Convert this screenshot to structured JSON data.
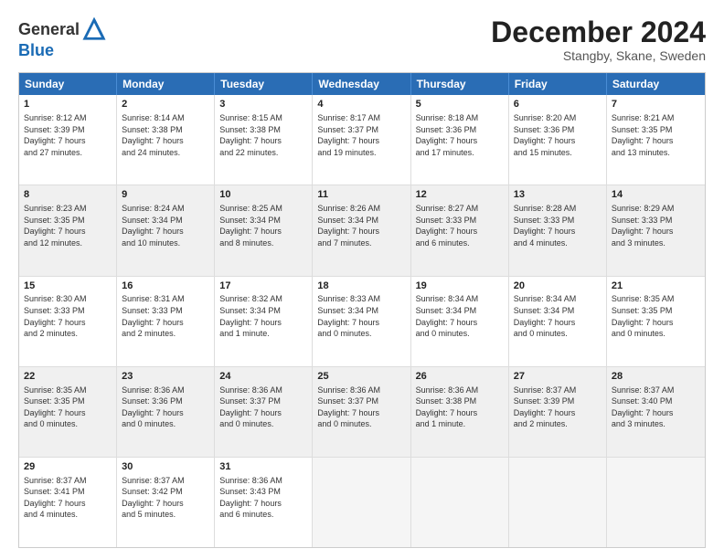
{
  "header": {
    "logo_general": "General",
    "logo_blue": "Blue",
    "month_title": "December 2024",
    "location": "Stangby, Skane, Sweden"
  },
  "weekdays": [
    "Sunday",
    "Monday",
    "Tuesday",
    "Wednesday",
    "Thursday",
    "Friday",
    "Saturday"
  ],
  "rows": [
    [
      {
        "day": "1",
        "lines": [
          "Sunrise: 8:12 AM",
          "Sunset: 3:39 PM",
          "Daylight: 7 hours",
          "and 27 minutes."
        ]
      },
      {
        "day": "2",
        "lines": [
          "Sunrise: 8:14 AM",
          "Sunset: 3:38 PM",
          "Daylight: 7 hours",
          "and 24 minutes."
        ]
      },
      {
        "day": "3",
        "lines": [
          "Sunrise: 8:15 AM",
          "Sunset: 3:38 PM",
          "Daylight: 7 hours",
          "and 22 minutes."
        ]
      },
      {
        "day": "4",
        "lines": [
          "Sunrise: 8:17 AM",
          "Sunset: 3:37 PM",
          "Daylight: 7 hours",
          "and 19 minutes."
        ]
      },
      {
        "day": "5",
        "lines": [
          "Sunrise: 8:18 AM",
          "Sunset: 3:36 PM",
          "Daylight: 7 hours",
          "and 17 minutes."
        ]
      },
      {
        "day": "6",
        "lines": [
          "Sunrise: 8:20 AM",
          "Sunset: 3:36 PM",
          "Daylight: 7 hours",
          "and 15 minutes."
        ]
      },
      {
        "day": "7",
        "lines": [
          "Sunrise: 8:21 AM",
          "Sunset: 3:35 PM",
          "Daylight: 7 hours",
          "and 13 minutes."
        ]
      }
    ],
    [
      {
        "day": "8",
        "lines": [
          "Sunrise: 8:23 AM",
          "Sunset: 3:35 PM",
          "Daylight: 7 hours",
          "and 12 minutes."
        ]
      },
      {
        "day": "9",
        "lines": [
          "Sunrise: 8:24 AM",
          "Sunset: 3:34 PM",
          "Daylight: 7 hours",
          "and 10 minutes."
        ]
      },
      {
        "day": "10",
        "lines": [
          "Sunrise: 8:25 AM",
          "Sunset: 3:34 PM",
          "Daylight: 7 hours",
          "and 8 minutes."
        ]
      },
      {
        "day": "11",
        "lines": [
          "Sunrise: 8:26 AM",
          "Sunset: 3:34 PM",
          "Daylight: 7 hours",
          "and 7 minutes."
        ]
      },
      {
        "day": "12",
        "lines": [
          "Sunrise: 8:27 AM",
          "Sunset: 3:33 PM",
          "Daylight: 7 hours",
          "and 6 minutes."
        ]
      },
      {
        "day": "13",
        "lines": [
          "Sunrise: 8:28 AM",
          "Sunset: 3:33 PM",
          "Daylight: 7 hours",
          "and 4 minutes."
        ]
      },
      {
        "day": "14",
        "lines": [
          "Sunrise: 8:29 AM",
          "Sunset: 3:33 PM",
          "Daylight: 7 hours",
          "and 3 minutes."
        ]
      }
    ],
    [
      {
        "day": "15",
        "lines": [
          "Sunrise: 8:30 AM",
          "Sunset: 3:33 PM",
          "Daylight: 7 hours",
          "and 2 minutes."
        ]
      },
      {
        "day": "16",
        "lines": [
          "Sunrise: 8:31 AM",
          "Sunset: 3:33 PM",
          "Daylight: 7 hours",
          "and 2 minutes."
        ]
      },
      {
        "day": "17",
        "lines": [
          "Sunrise: 8:32 AM",
          "Sunset: 3:34 PM",
          "Daylight: 7 hours",
          "and 1 minute."
        ]
      },
      {
        "day": "18",
        "lines": [
          "Sunrise: 8:33 AM",
          "Sunset: 3:34 PM",
          "Daylight: 7 hours",
          "and 0 minutes."
        ]
      },
      {
        "day": "19",
        "lines": [
          "Sunrise: 8:34 AM",
          "Sunset: 3:34 PM",
          "Daylight: 7 hours",
          "and 0 minutes."
        ]
      },
      {
        "day": "20",
        "lines": [
          "Sunrise: 8:34 AM",
          "Sunset: 3:34 PM",
          "Daylight: 7 hours",
          "and 0 minutes."
        ]
      },
      {
        "day": "21",
        "lines": [
          "Sunrise: 8:35 AM",
          "Sunset: 3:35 PM",
          "Daylight: 7 hours",
          "and 0 minutes."
        ]
      }
    ],
    [
      {
        "day": "22",
        "lines": [
          "Sunrise: 8:35 AM",
          "Sunset: 3:35 PM",
          "Daylight: 7 hours",
          "and 0 minutes."
        ]
      },
      {
        "day": "23",
        "lines": [
          "Sunrise: 8:36 AM",
          "Sunset: 3:36 PM",
          "Daylight: 7 hours",
          "and 0 minutes."
        ]
      },
      {
        "day": "24",
        "lines": [
          "Sunrise: 8:36 AM",
          "Sunset: 3:37 PM",
          "Daylight: 7 hours",
          "and 0 minutes."
        ]
      },
      {
        "day": "25",
        "lines": [
          "Sunrise: 8:36 AM",
          "Sunset: 3:37 PM",
          "Daylight: 7 hours",
          "and 0 minutes."
        ]
      },
      {
        "day": "26",
        "lines": [
          "Sunrise: 8:36 AM",
          "Sunset: 3:38 PM",
          "Daylight: 7 hours",
          "and 1 minute."
        ]
      },
      {
        "day": "27",
        "lines": [
          "Sunrise: 8:37 AM",
          "Sunset: 3:39 PM",
          "Daylight: 7 hours",
          "and 2 minutes."
        ]
      },
      {
        "day": "28",
        "lines": [
          "Sunrise: 8:37 AM",
          "Sunset: 3:40 PM",
          "Daylight: 7 hours",
          "and 3 minutes."
        ]
      }
    ],
    [
      {
        "day": "29",
        "lines": [
          "Sunrise: 8:37 AM",
          "Sunset: 3:41 PM",
          "Daylight: 7 hours",
          "and 4 minutes."
        ]
      },
      {
        "day": "30",
        "lines": [
          "Sunrise: 8:37 AM",
          "Sunset: 3:42 PM",
          "Daylight: 7 hours",
          "and 5 minutes."
        ]
      },
      {
        "day": "31",
        "lines": [
          "Sunrise: 8:36 AM",
          "Sunset: 3:43 PM",
          "Daylight: 7 hours",
          "and 6 minutes."
        ]
      },
      {
        "day": "",
        "lines": []
      },
      {
        "day": "",
        "lines": []
      },
      {
        "day": "",
        "lines": []
      },
      {
        "day": "",
        "lines": []
      }
    ]
  ]
}
